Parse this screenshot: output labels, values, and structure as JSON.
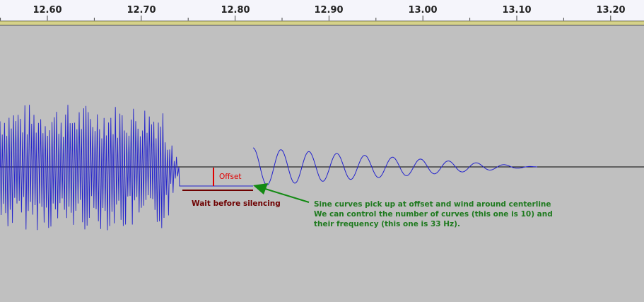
{
  "timeline": {
    "ticks": [
      "12.60",
      "12.70",
      "12.80",
      "12.90",
      "13.00",
      "13.10",
      "13.20"
    ]
  },
  "annotations": {
    "offset_label": "Offset",
    "wait_label": "Wait before silencing",
    "sine_note": [
      "Sine curves pick up at offset and wind around centerline",
      "We can control the number of curves (this one is 10) and",
      "their frequency (this one is 33 Hz)."
    ]
  },
  "colors": {
    "background": "#c0c0c0",
    "waveform": "#2222cc",
    "centerline": "#000000",
    "offset_marker": "#e00000",
    "wait_marker": "#6e0000",
    "arrow": "#138a13"
  }
}
